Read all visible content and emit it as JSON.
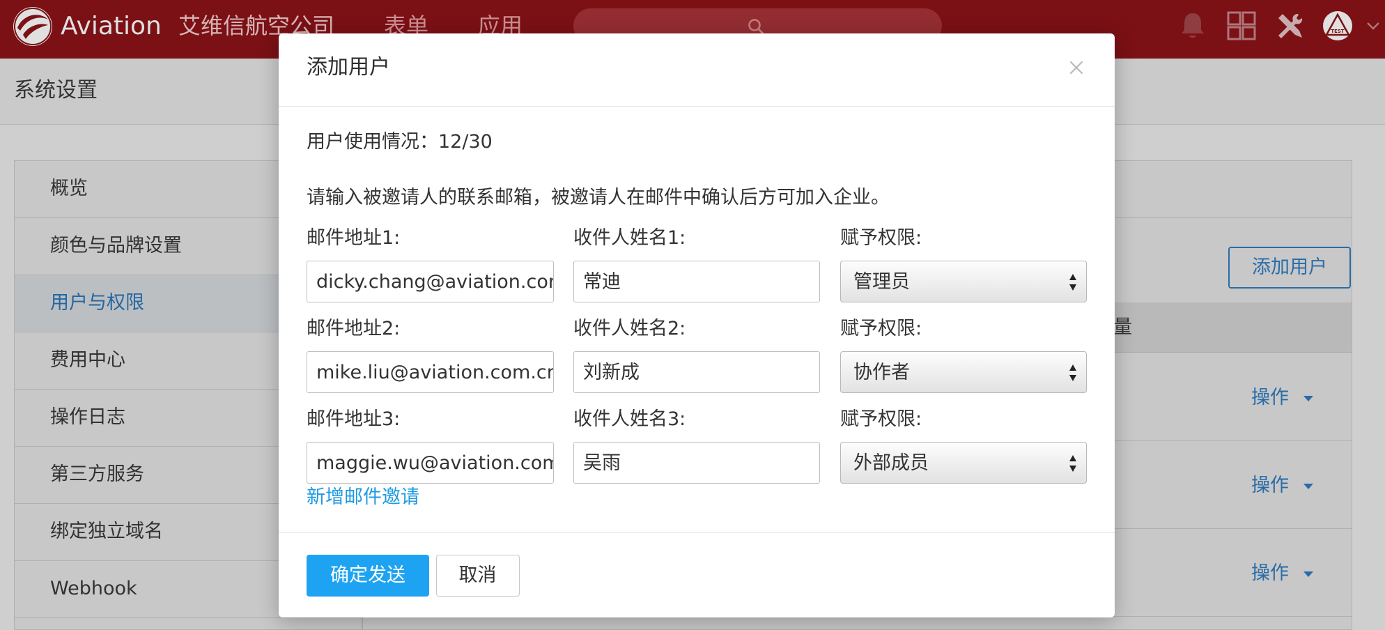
{
  "header": {
    "brand": "Aviation",
    "company": "艾维信航空公司",
    "nav": [
      "表单",
      "应用"
    ],
    "icons": [
      "bell-icon",
      "grid-icon",
      "tools-icon",
      "test-badge-icon"
    ]
  },
  "page": {
    "title": "系统设置"
  },
  "sidebar": {
    "items": [
      {
        "label": "概览"
      },
      {
        "label": "颜色与品牌设置"
      },
      {
        "label": "用户与权限",
        "active": true
      },
      {
        "label": "费用中心"
      },
      {
        "label": "操作日志"
      },
      {
        "label": "第三方服务"
      },
      {
        "label": "绑定独立域名"
      },
      {
        "label": "Webhook"
      }
    ]
  },
  "content": {
    "add_user_label": "添加用户",
    "table_header_fragment": "量",
    "row_action_label": "操作"
  },
  "modal": {
    "title": "添加用户",
    "usage": "用户使用情况：12/30",
    "instruction": "请输入被邀请人的联系邮箱，被邀请人在邮件中确认后方可加入企业。",
    "rows": [
      {
        "email_label": "邮件地址1:",
        "email": "dicky.chang@aviation.cor",
        "name_label": "收件人姓名1:",
        "name": "常迪",
        "role_label": "赋予权限:",
        "role": "管理员"
      },
      {
        "email_label": "邮件地址2:",
        "email": "mike.liu@aviation.com.cn",
        "name_label": "收件人姓名2:",
        "name": "刘新成",
        "role_label": "赋予权限:",
        "role": "协作者"
      },
      {
        "email_label": "邮件地址3:",
        "email": "maggie.wu@aviation.com",
        "name_label": "收件人姓名3:",
        "name": "吴雨",
        "role_label": "赋予权限:",
        "role": "外部成员"
      }
    ],
    "add_invite_label": "新增邮件邀请",
    "confirm_label": "确定发送",
    "cancel_label": "取消"
  },
  "colors": {
    "header_red": "#8d1318",
    "primary_blue": "#1ea3f2",
    "link_blue": "#1d9be2",
    "active_nav_blue": "#2a75b8"
  }
}
